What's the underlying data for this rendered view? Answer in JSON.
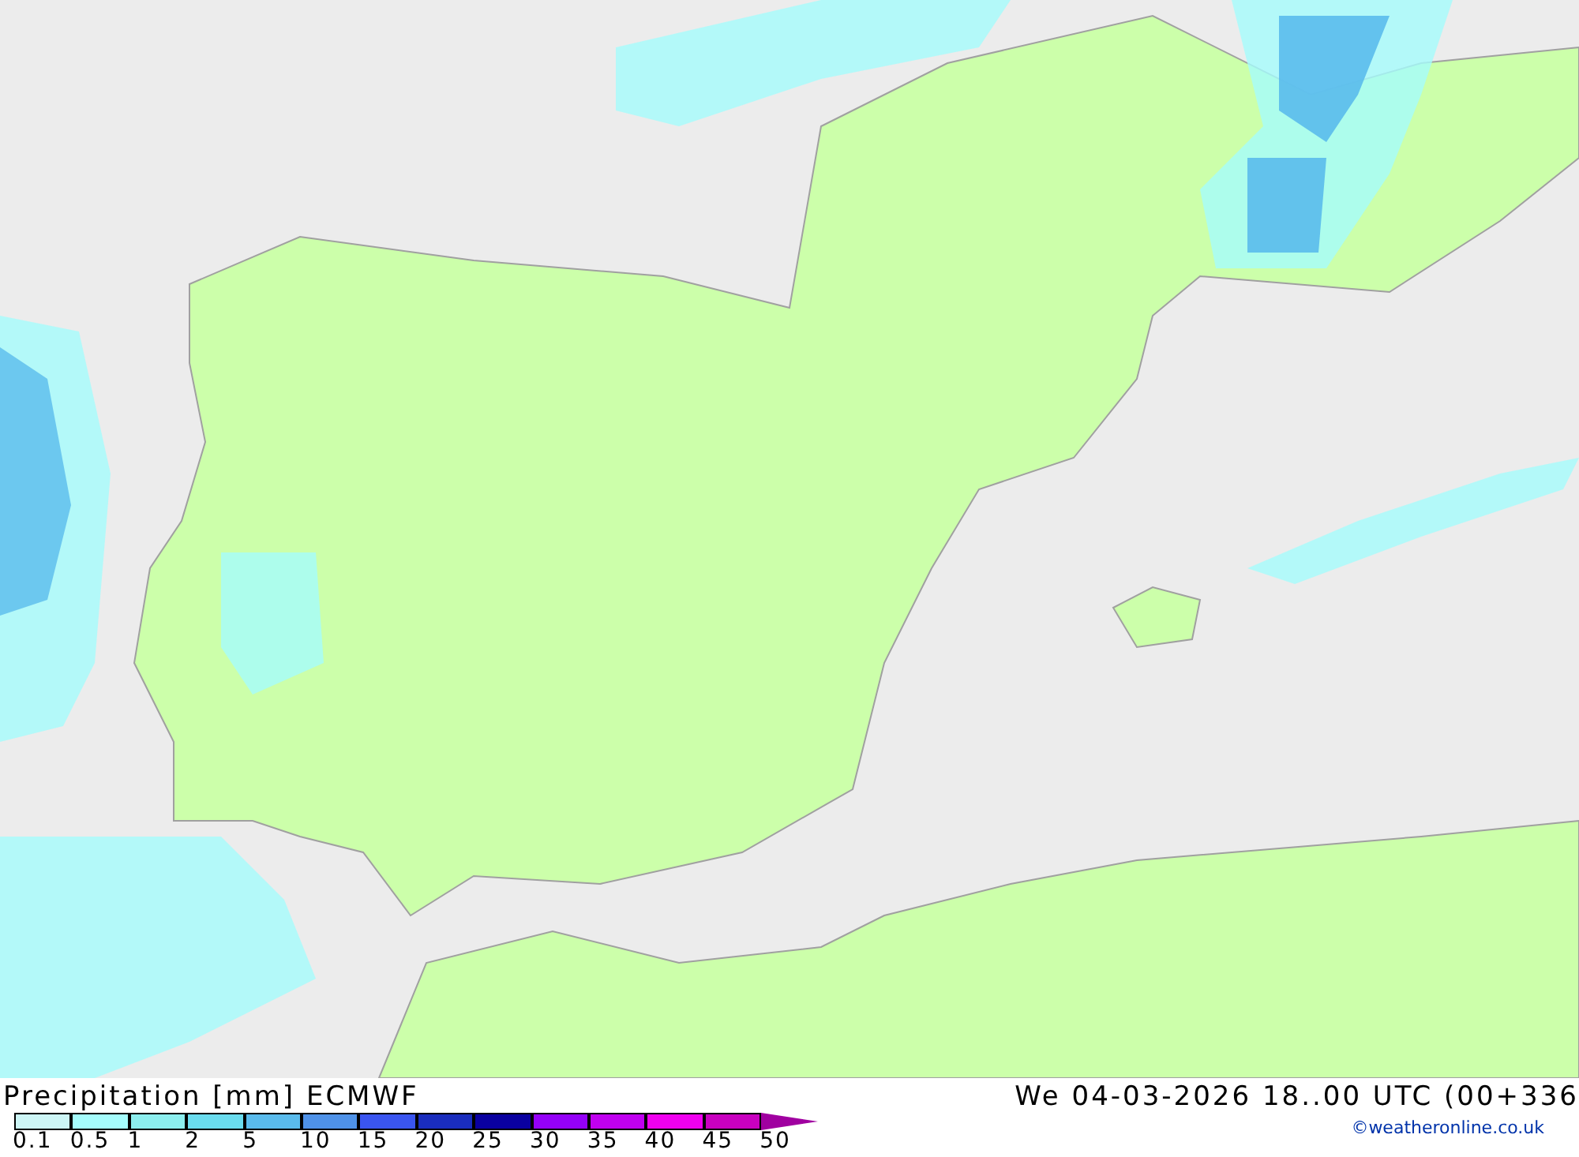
{
  "title": "Precipitation [mm] ECMWF",
  "valid_time": "We 04-03-2026 18..00 UTC (00+336",
  "legend": [
    {
      "label": "0.1",
      "color": "#cdf6f6"
    },
    {
      "label": "0.5",
      "color": "#a5fcfc"
    },
    {
      "label": "1",
      "color": "#8ceeee"
    },
    {
      "label": "2",
      "color": "#6adcee"
    },
    {
      "label": "5",
      "color": "#5abbec"
    },
    {
      "label": "10",
      "color": "#4f92e8"
    },
    {
      "label": "15",
      "color": "#3a55f0"
    },
    {
      "label": "20",
      "color": "#1a2dbe"
    },
    {
      "label": "25",
      "color": "#0a00a0"
    },
    {
      "label": "30",
      "color": "#9400f8"
    },
    {
      "label": "35",
      "color": "#c000f0"
    },
    {
      "label": "40",
      "color": "#f000f0"
    },
    {
      "label": "45",
      "color": "#c800c0"
    },
    {
      "label": "50",
      "color": "#a000a0"
    }
  ],
  "credit": "©weatheronline.co.uk"
}
